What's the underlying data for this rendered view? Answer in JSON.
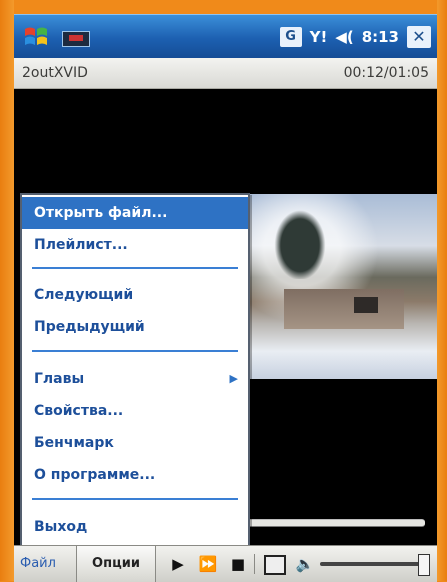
{
  "system_bar": {
    "tray_g": "G",
    "signal": "Y!",
    "volume": "◀(",
    "clock": "8:13",
    "close": "✕"
  },
  "title_bar": {
    "app_name": "2outXVID",
    "time": "00:12/01:05"
  },
  "file_menu": {
    "items": [
      {
        "label": "Открыть файл..."
      },
      {
        "label": "Плейлист..."
      },
      {
        "label": "Следующий"
      },
      {
        "label": "Предыдущий"
      },
      {
        "label": "Главы"
      },
      {
        "label": "Свойства..."
      },
      {
        "label": "Бенчмарк"
      },
      {
        "label": "О программе..."
      },
      {
        "label": "Выход"
      }
    ],
    "selected_index": 0
  },
  "toolbar": {
    "file_label": "Файл",
    "options_label": "Опции",
    "play": "▶",
    "fast_forward": "⏩",
    "stop": "■",
    "volume": "🔈"
  },
  "colors": {
    "frame": "#f08a1a",
    "system_bar": "#1c5fb0",
    "menu_highlight": "#2e72c4",
    "menu_text": "#1d4f9a"
  },
  "icons": [
    "windows-start-icon",
    "app-thumbnail-icon",
    "signal-icon",
    "volume-icon",
    "close-icon",
    "play-icon",
    "fast-forward-icon",
    "stop-icon",
    "fullscreen-icon",
    "speaker-icon"
  ]
}
